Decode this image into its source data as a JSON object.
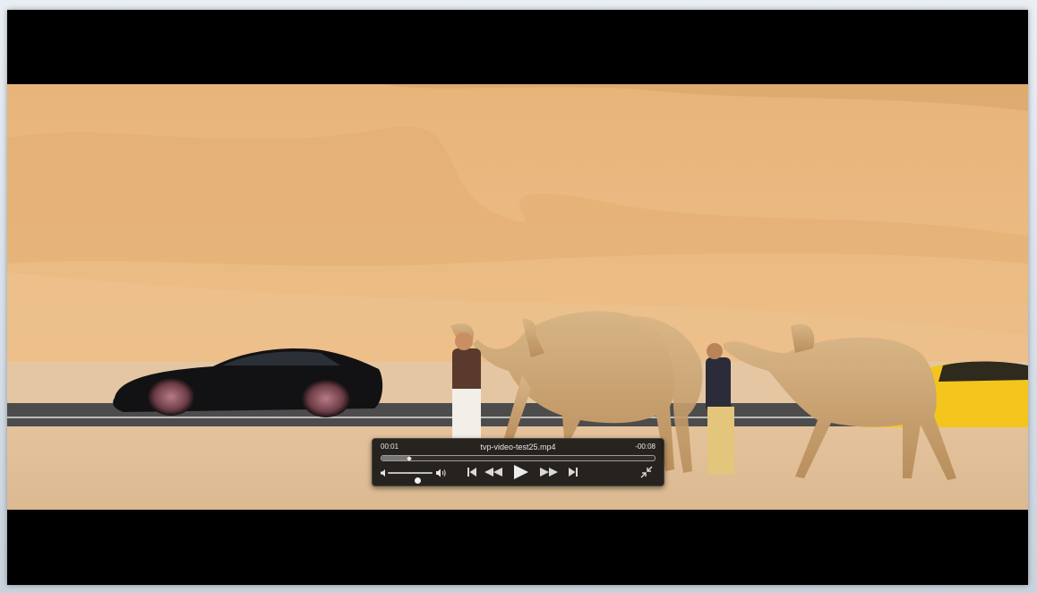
{
  "player": {
    "title": "tvp-video-test25.mp4",
    "time_elapsed": "00:01",
    "time_remaining": "-00:08",
    "progress_fraction": 0.1,
    "volume_fraction": 0.65
  },
  "icons": {
    "volume_low": "speaker-low-icon",
    "volume_high": "speaker-high-icon",
    "skip_back": "skip-back-icon",
    "rewind": "rewind-icon",
    "play": "play-icon",
    "fast_forward": "fast-forward-icon",
    "skip_forward": "skip-forward-icon",
    "exit_fullscreen": "exit-fullscreen-icon"
  },
  "colors": {
    "letterbox": "#000000",
    "hud_background": "#0c0c0c",
    "hud_text": "#e6e6e6"
  }
}
